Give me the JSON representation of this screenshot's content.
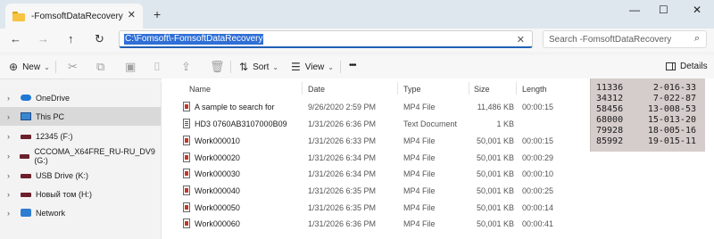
{
  "window": {
    "tab_title": "-FomsoftDataRecovery",
    "close_tab_glyph": "✕",
    "new_tab_glyph": "+",
    "minimize_glyph": "—",
    "maximize_glyph": "☐",
    "close_glyph": "✕"
  },
  "nav": {
    "back_glyph": "←",
    "forward_glyph": "→",
    "up_glyph": "↑",
    "refresh_glyph": "↻",
    "address_path": "C:\\Fomsoft\\-FomsoftDataRecovery",
    "address_clear_glyph": "✕",
    "search_placeholder": "Search -FomsoftDataRecovery",
    "search_glyph": "⌕"
  },
  "commands": {
    "new_label": "New",
    "sort_label": "Sort",
    "view_label": "View",
    "more_glyph": "•••",
    "details_label": "Details"
  },
  "sidebar": {
    "items": [
      {
        "label": "OneDrive",
        "icon": "cloud-icon"
      },
      {
        "label": "This PC",
        "icon": "computer-icon"
      },
      {
        "label": "12345 (F:)",
        "icon": "drive-icon"
      },
      {
        "label": "CCCOMA_X64FRE_RU-RU_DV9 (G:)",
        "icon": "drive-icon"
      },
      {
        "label": "USB Drive (K:)",
        "icon": "usb-drive-icon"
      },
      {
        "label": "Новый том (H:)",
        "icon": "drive-icon"
      },
      {
        "label": "Network",
        "icon": "network-icon"
      }
    ]
  },
  "columns": {
    "name": "Name",
    "date": "Date",
    "type": "Type",
    "size": "Size",
    "length": "Length"
  },
  "files": [
    {
      "name": "A sample to search for",
      "date": "9/26/2020 2:59 PM",
      "type": "MP4 File",
      "size": "11,486 KB",
      "length": "00:00:15",
      "kind": "mp4"
    },
    {
      "name": "HD3 0760AB3107000B09",
      "date": "1/31/2026 6:36 PM",
      "type": "Text Document",
      "size": "1 KB",
      "length": "",
      "kind": "txt"
    },
    {
      "name": "Work000010",
      "date": "1/31/2026 6:33 PM",
      "type": "MP4 File",
      "size": "50,001 KB",
      "length": "00:00:15",
      "kind": "mp4"
    },
    {
      "name": "Work000020",
      "date": "1/31/2026 6:34 PM",
      "type": "MP4 File",
      "size": "50,001 KB",
      "length": "00:00:29",
      "kind": "mp4"
    },
    {
      "name": "Work000030",
      "date": "1/31/2026 6:34 PM",
      "type": "MP4 File",
      "size": "50,001 KB",
      "length": "00:00:10",
      "kind": "mp4"
    },
    {
      "name": "Work000040",
      "date": "1/31/2026 6:35 PM",
      "type": "MP4 File",
      "size": "50,001 KB",
      "length": "00:00:25",
      "kind": "mp4"
    },
    {
      "name": "Work000050",
      "date": "1/31/2026 6:35 PM",
      "type": "MP4 File",
      "size": "50,001 KB",
      "length": "00:00:14",
      "kind": "mp4"
    },
    {
      "name": "Work000060",
      "date": "1/31/2026 6:36 PM",
      "type": "MP4 File",
      "size": "50,001 KB",
      "length": "00:00:41",
      "kind": "mp4"
    }
  ],
  "overlay_note": [
    {
      "a": "11336",
      "b": "2-016-33"
    },
    {
      "a": "34312",
      "b": "7-022-87"
    },
    {
      "a": "58456",
      "b": "13-008-53"
    },
    {
      "a": "68000",
      "b": "15-013-20"
    },
    {
      "a": "79928",
      "b": "18-005-16"
    },
    {
      "a": "85992",
      "b": "19-015-11"
    }
  ],
  "colors": {
    "accent": "#2f6fd6",
    "selection": "#d9d9d9",
    "overlay_bg": "#d5cdcb"
  }
}
